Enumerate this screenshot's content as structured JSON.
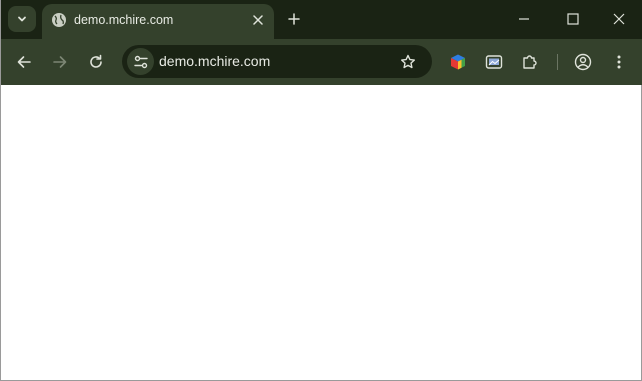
{
  "tab": {
    "title": "demo.mchire.com",
    "favicon": "globe-icon"
  },
  "omnibox": {
    "url": "demo.mchire.com"
  },
  "icons": {
    "tab_search": "chevron-down-icon",
    "tab_close": "close-icon",
    "new_tab": "plus-icon",
    "minimize": "minimize-icon",
    "maximize": "maximize-icon",
    "close_window": "close-icon",
    "back": "arrow-left-icon",
    "forward": "arrow-right-icon",
    "reload": "reload-icon",
    "site_info": "tune-icon",
    "bookmark": "star-icon",
    "extension_1": "cube-icon",
    "extension_2": "screenshot-icon",
    "extensions": "puzzle-icon",
    "profile": "profile-icon",
    "menu": "more-vertical-icon"
  },
  "colors": {
    "titlebar": "#1a2314",
    "toolbar": "#34412c",
    "icon": "#dfe3da",
    "icon_disabled": "#7c8674",
    "page_background": "#ffffff"
  }
}
